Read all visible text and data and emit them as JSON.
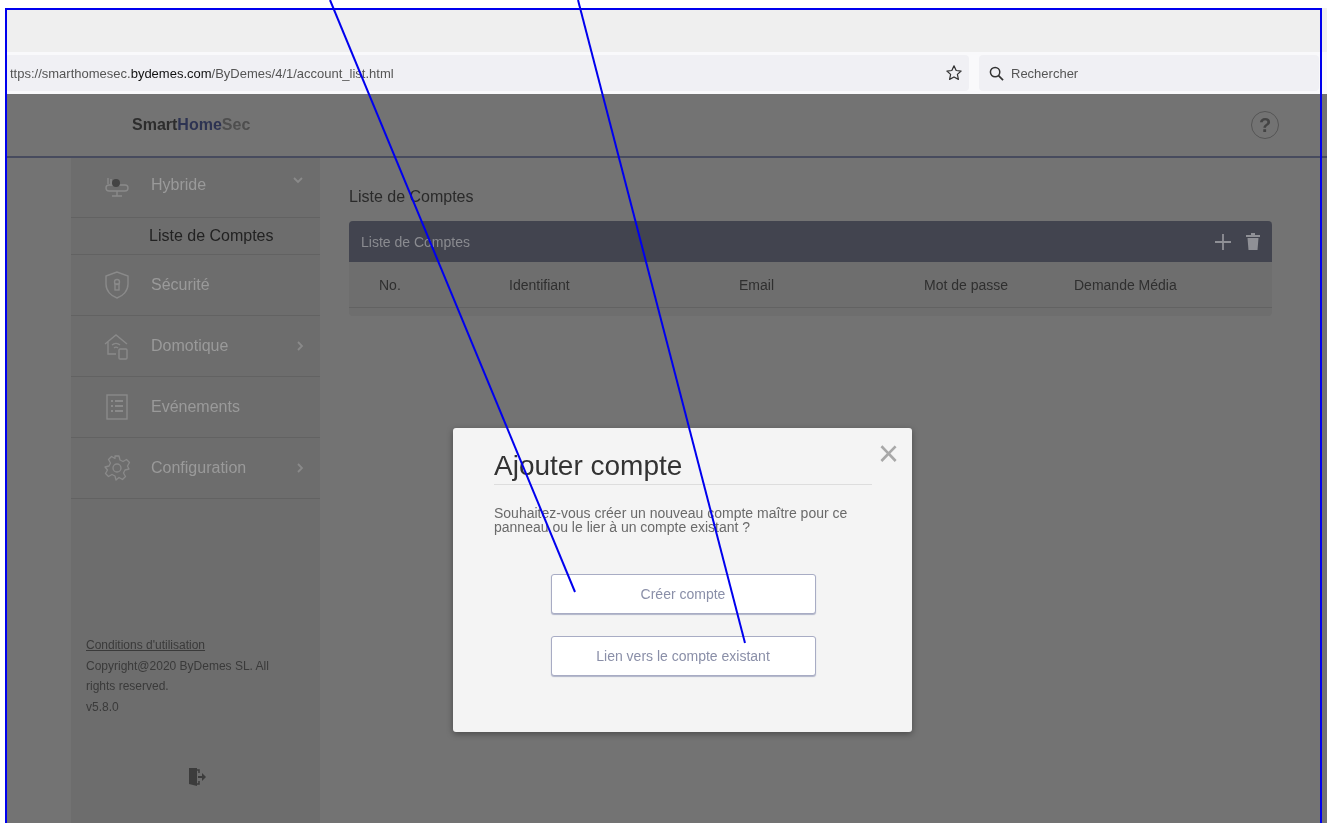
{
  "browser": {
    "url_parts": [
      "ttps://smarthomesec.",
      "bydemes.com",
      "/ByDemes/4/1/account_list.html"
    ],
    "search": {
      "placeholder": "Rechercher"
    }
  },
  "header": {
    "logo_parts": [
      "Smart",
      "Home",
      "Sec"
    ],
    "help": "?"
  },
  "sidebar": {
    "items": [
      {
        "label": "Hybride",
        "kind": "hybrid",
        "expanded": true,
        "children": [
          {
            "label": "Liste de Comptes",
            "selected": true
          }
        ]
      },
      {
        "label": "Sécurité",
        "kind": "shield"
      },
      {
        "label": "Domotique",
        "kind": "home",
        "expanded": false
      },
      {
        "label": "Evénements",
        "kind": "list"
      },
      {
        "label": "Configuration",
        "kind": "gear",
        "expanded": false
      }
    ],
    "footer": {
      "terms": "Conditions d'utilisation",
      "copyright": "Copyright@2020 ByDemes SL. All rights reserved.",
      "version": "v5.8.0"
    }
  },
  "main": {
    "title": "Liste de Comptes",
    "table": {
      "title": "Liste de Comptes",
      "columns": [
        "No.",
        "Identifiant",
        "Email",
        "Mot de passe",
        "Demande Média"
      ]
    }
  },
  "dialog": {
    "title": "Ajouter compte",
    "close": "×",
    "message": "Souhaitez-vous créer un nouveau compte maître pour ce panneau ou le lier à un compte existant ?",
    "buttons": [
      "Créer compte",
      "Lien vers le compte existant"
    ]
  }
}
